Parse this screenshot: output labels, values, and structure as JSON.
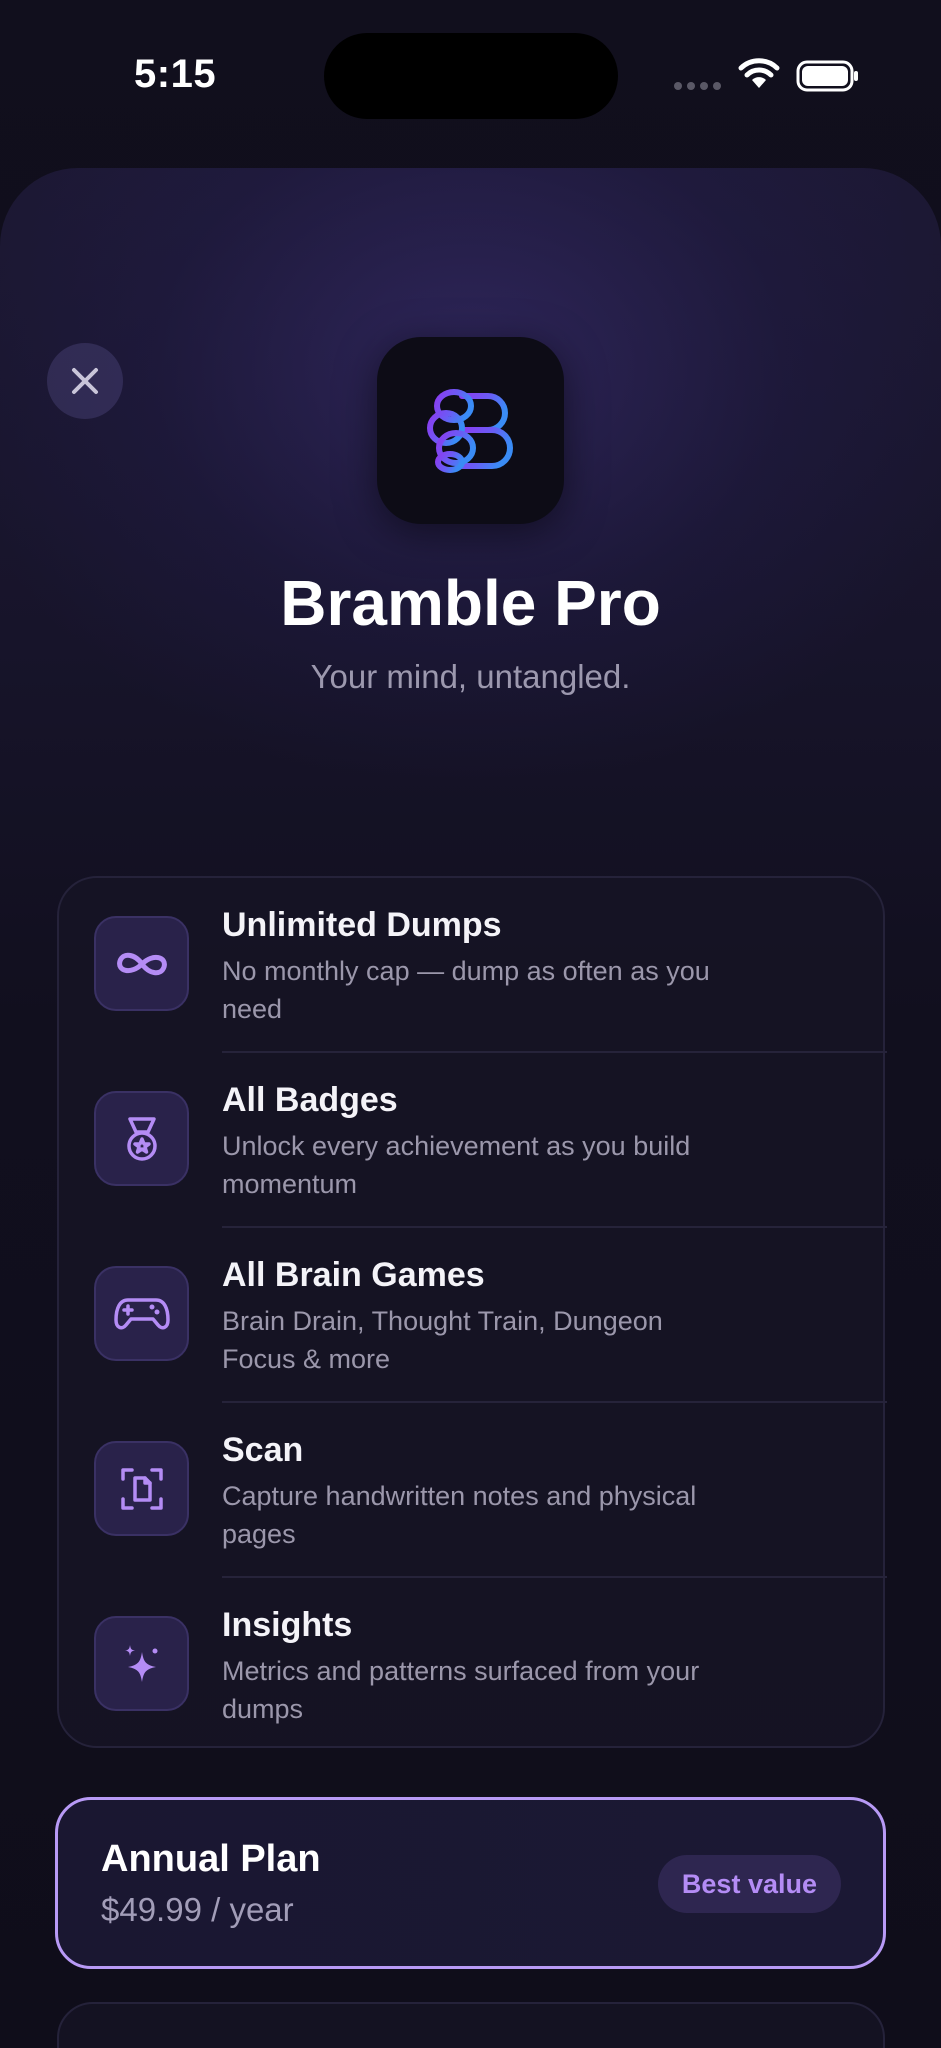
{
  "status_bar": {
    "time": "5:15"
  },
  "header": {
    "title": "Bramble Pro",
    "subtitle": "Your mind, untangled.",
    "close_icon": "close-icon",
    "app_icon": "bramble-logo"
  },
  "features": [
    {
      "icon": "infinity-icon",
      "title": "Unlimited Dumps",
      "description": "No monthly cap — dump as often as you need"
    },
    {
      "icon": "medal-icon",
      "title": "All Badges",
      "description": "Unlock every achievement as you build momentum"
    },
    {
      "icon": "gamepad-icon",
      "title": "All Brain Games",
      "description": "Brain Drain, Thought Train, Dungeon Focus & more"
    },
    {
      "icon": "scan-icon",
      "title": "Scan",
      "description": "Capture handwritten notes and physical pages"
    },
    {
      "icon": "sparkles-icon",
      "title": "Insights",
      "description": "Metrics and patterns surfaced from your dumps"
    }
  ],
  "plans": [
    {
      "name": "Annual Plan",
      "price": "$49.99 / year",
      "badge": "Best value",
      "selected": true
    }
  ],
  "colors": {
    "accent": "#b48cf5",
    "selected_border": "#b89af6",
    "background": "#0f0d1a",
    "icon_tile": "#29224a"
  }
}
